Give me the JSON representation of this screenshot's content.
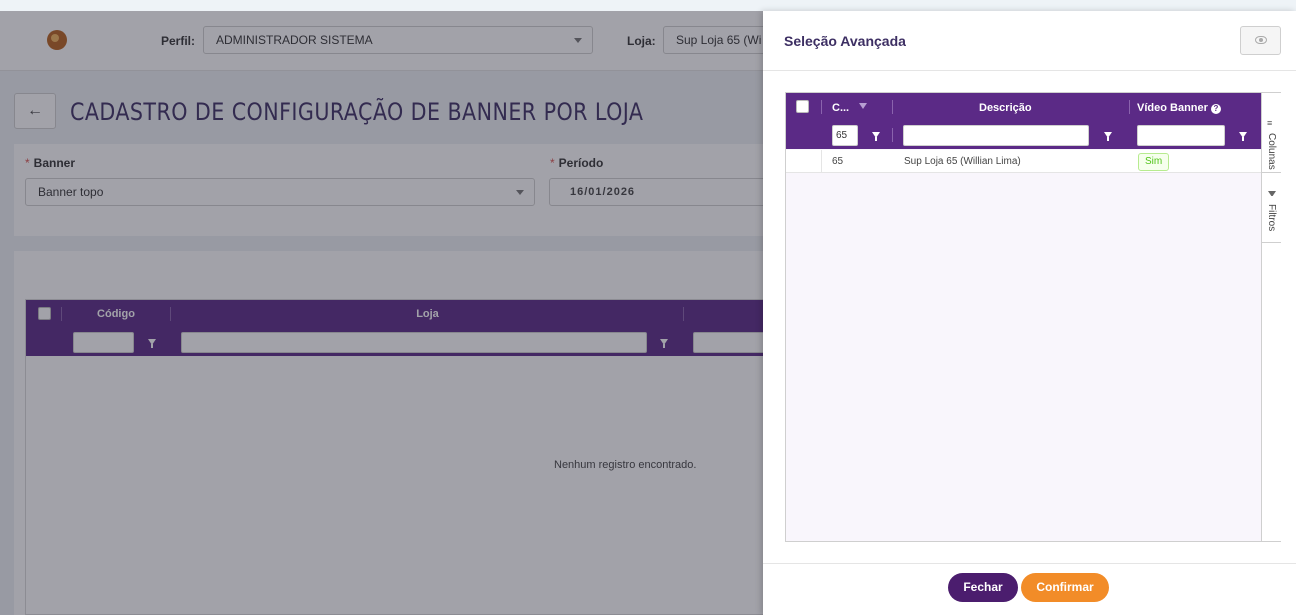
{
  "header": {
    "perfil_label": "Perfil:",
    "perfil_value": "ADMINISTRADOR SISTEMA",
    "loja_label": "Loja:",
    "loja_value": "Sup Loja 65 (Wi"
  },
  "page": {
    "title": "CADASTRO DE CONFIGURAÇÃO DE BANNER POR LOJA",
    "banner_label": "Banner",
    "banner_value": "Banner topo",
    "periodo_label": "Período",
    "periodo_value": "16/01/2026"
  },
  "bg_grid": {
    "columns": [
      "Código",
      "Loja"
    ],
    "empty_message": "Nenhum registro encontrado."
  },
  "drawer": {
    "title": "Seleção Avançada",
    "columns": [
      "C...",
      "Descrição",
      "Vídeo Banner"
    ],
    "filter_codigo_value": "65",
    "rows": [
      {
        "codigo": "65",
        "descricao": "Sup Loja 65 (Willian Lima)",
        "video_banner": "Sim"
      }
    ],
    "side_tabs": [
      "Colunas",
      "Filtros"
    ],
    "buttons": {
      "fechar": "Fechar",
      "confirmar": "Confirmar"
    }
  },
  "colors": {
    "primary_purple": "#5b2a86",
    "dark_purple": "#4b1d6e",
    "orange": "#f28c28",
    "success_green": "#52c41a"
  },
  "icons": [
    "logo-icon",
    "chevron-down-icon",
    "arrow-left-icon",
    "eye-icon",
    "filter-icon",
    "help-icon",
    "columns-icon"
  ]
}
